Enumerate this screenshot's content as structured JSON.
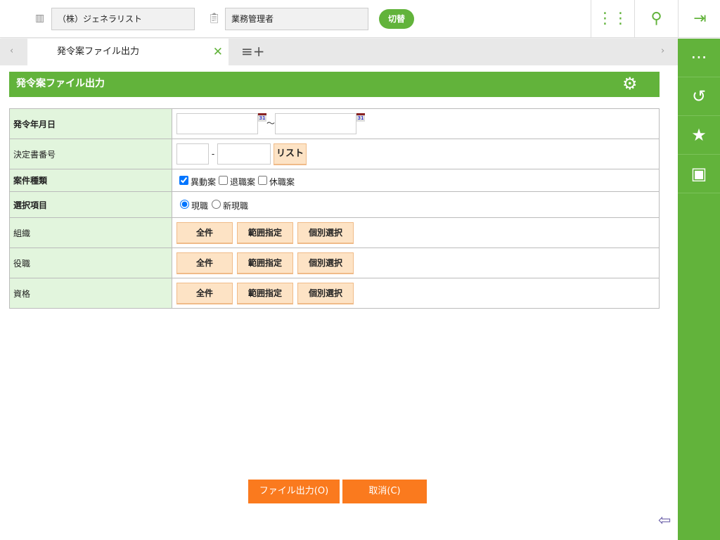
{
  "header": {
    "company": "（株）ジェネラリスト",
    "role": "業務管理者",
    "switch_label": "切替"
  },
  "tab": {
    "label": "発令案ファイル出力"
  },
  "page": {
    "title": "発令案ファイル出力"
  },
  "form": {
    "date_label": "発令年月日",
    "tilde": "～",
    "cal": "31",
    "docno_label": "決定書番号",
    "dash": "-",
    "list_button": "リスト",
    "type_label": "案件種類",
    "types": [
      "異動案",
      "退職案",
      "休職案"
    ],
    "select_label": "選択項目",
    "selects": [
      "現職",
      "新現職"
    ],
    "rows": [
      {
        "label": "組織"
      },
      {
        "label": "役職"
      },
      {
        "label": "資格"
      }
    ],
    "buttons": [
      "全件",
      "範囲指定",
      "個別選択"
    ]
  },
  "footer": {
    "export": "ファイル出力(O)",
    "cancel": "取消(C)"
  }
}
